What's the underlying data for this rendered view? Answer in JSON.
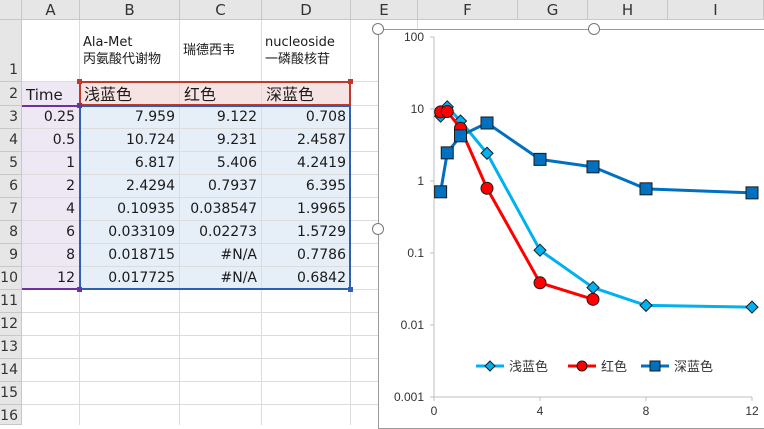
{
  "columns": [
    "A",
    "B",
    "C",
    "D",
    "E",
    "F",
    "G",
    "H",
    "I"
  ],
  "rows": [
    "1",
    "2",
    "3",
    "4",
    "5",
    "6",
    "7",
    "8",
    "9",
    "10",
    "11",
    "12",
    "13",
    "14",
    "15",
    "16"
  ],
  "header_row1": {
    "b": [
      "Ala-Met",
      "丙氨酸代谢物"
    ],
    "c": "瑞德西韦",
    "d": [
      "nucleoside",
      "一磷酸核苷"
    ]
  },
  "header_row2": {
    "a": "Time",
    "b": "浅蓝色",
    "c": "红色",
    "d": "深蓝色"
  },
  "table": [
    [
      "0.25",
      "7.959",
      "9.122",
      "0.708"
    ],
    [
      "0.5",
      "10.724",
      "9.231",
      "2.4587"
    ],
    [
      "1",
      "6.817",
      "5.406",
      "4.2419"
    ],
    [
      "2",
      "2.4294",
      "0.7937",
      "6.395"
    ],
    [
      "4",
      "0.10935",
      "0.038547",
      "1.9965"
    ],
    [
      "6",
      "0.033109",
      "0.02273",
      "1.5729"
    ],
    [
      "8",
      "0.018715",
      "#N/A",
      "0.7786"
    ],
    [
      "12",
      "0.017725",
      "#N/A",
      "0.6842"
    ]
  ],
  "colors": {
    "light_blue": "#00b0f0",
    "red": "#ff0000",
    "dark_blue": "#0070c0"
  },
  "chart_data": {
    "type": "line",
    "y_scale": "log",
    "ylim": [
      0.001,
      100
    ],
    "xlim": [
      0,
      12
    ],
    "y_ticks": [
      "100",
      "10",
      "1",
      "0.1",
      "0.01",
      "0.001"
    ],
    "x_ticks": [
      "0",
      "4",
      "8",
      "12"
    ],
    "legend_position": "bottom",
    "series": [
      {
        "name": "浅蓝色",
        "color": "#00b0f0",
        "marker": "diamond",
        "x": [
          0.25,
          0.5,
          1,
          2,
          4,
          6,
          8,
          12
        ],
        "y": [
          7.959,
          10.724,
          6.817,
          2.4294,
          0.10935,
          0.033109,
          0.018715,
          0.017725
        ]
      },
      {
        "name": "红色",
        "color": "#ff0000",
        "marker": "circle",
        "x": [
          0.25,
          0.5,
          1,
          2,
          4,
          6
        ],
        "y": [
          9.122,
          9.231,
          5.406,
          0.7937,
          0.038547,
          0.02273
        ]
      },
      {
        "name": "深蓝色",
        "color": "#0070c0",
        "marker": "square",
        "x": [
          0.25,
          0.5,
          1,
          2,
          4,
          6,
          8,
          12
        ],
        "y": [
          0.708,
          2.4587,
          4.2419,
          6.395,
          1.9965,
          1.5729,
          0.7786,
          0.6842
        ]
      }
    ]
  }
}
